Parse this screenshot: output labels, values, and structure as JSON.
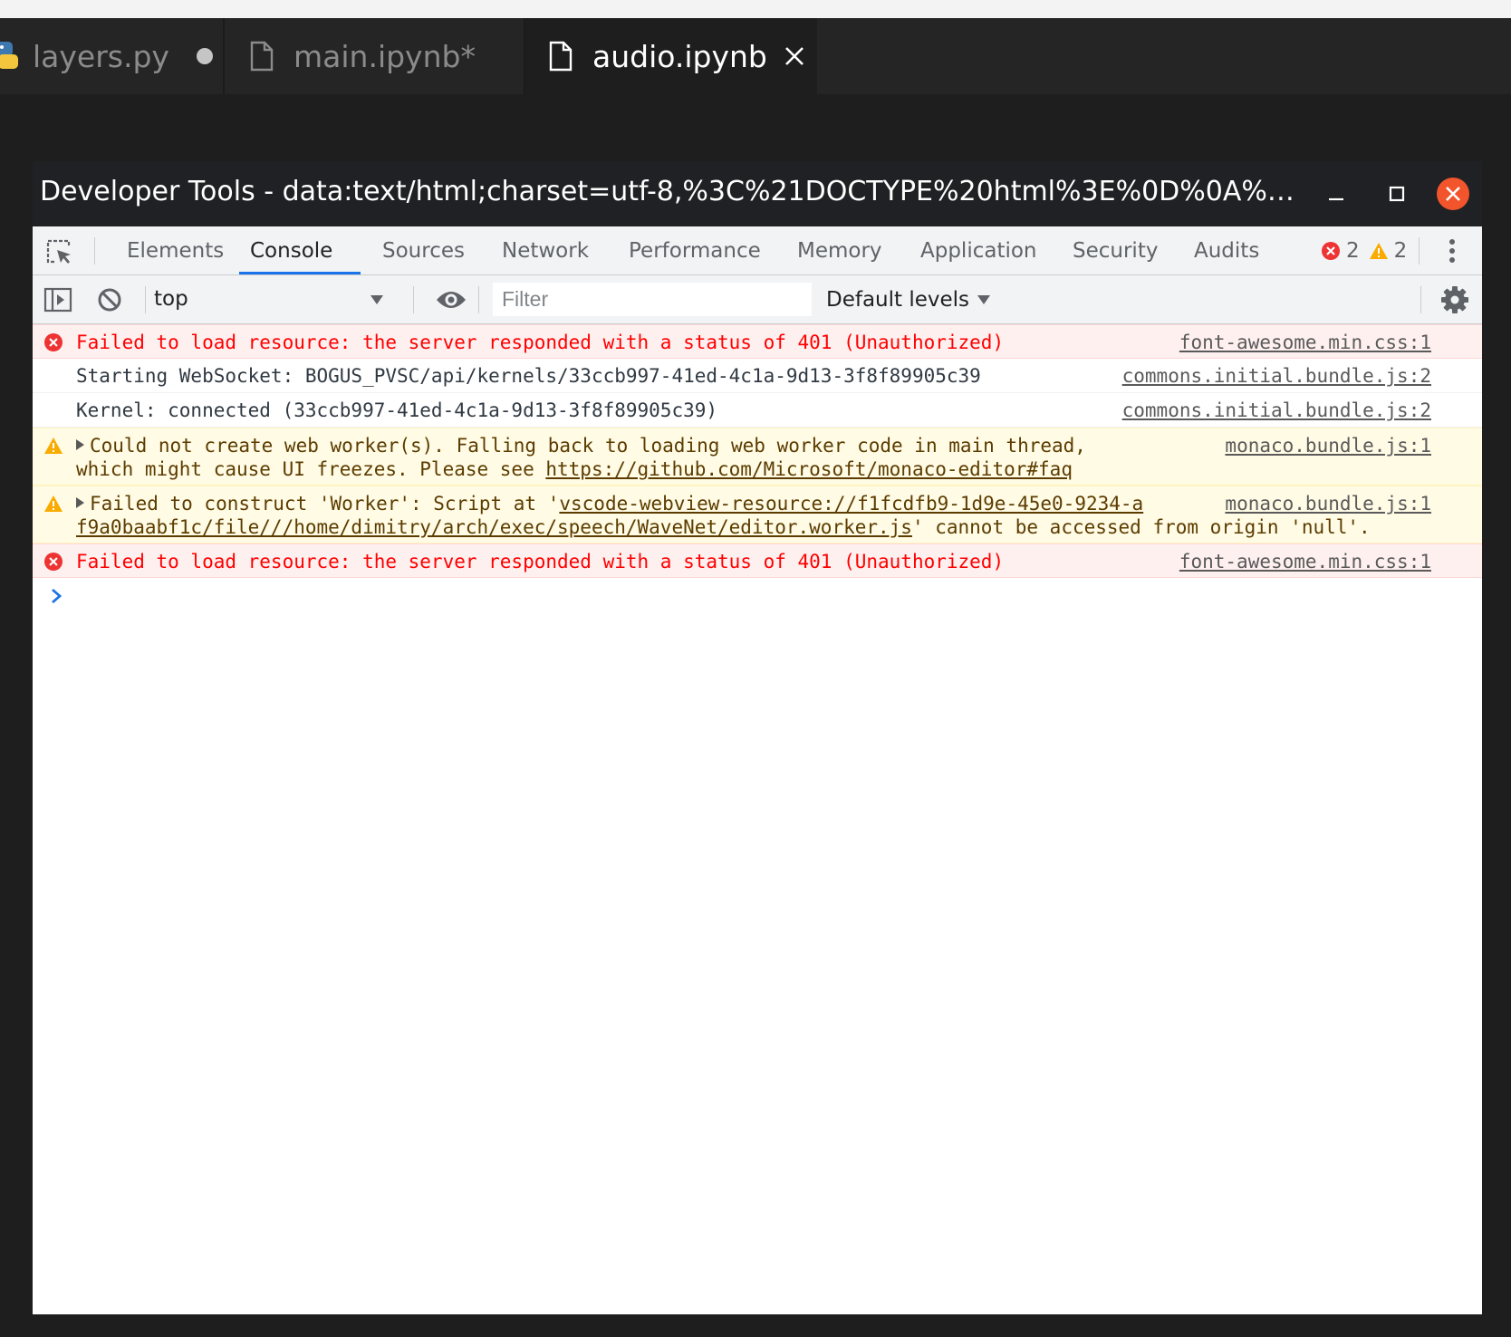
{
  "editor_tabs": [
    {
      "label": "layers.py",
      "icon": "python-icon",
      "status": "dirty-dot"
    },
    {
      "label": "main.ipynb*",
      "icon": "file-icon",
      "status": ""
    },
    {
      "label": "audio.ipynb",
      "icon": "file-icon",
      "status": "close"
    }
  ],
  "devtools": {
    "title": "Developer Tools - data:text/html;charset=utf-8,%3C%21DOCTYPE%20html%3E%0D%0A%3Chtml%...",
    "panel_tabs": [
      "Elements",
      "Console",
      "Sources",
      "Network",
      "Performance",
      "Memory",
      "Application",
      "Security",
      "Audits"
    ],
    "active_tab": "Console",
    "error_count": "2",
    "warning_count": "2",
    "toolbar": {
      "context": "top",
      "filter_placeholder": "Filter",
      "levels": "Default levels"
    },
    "messages": [
      {
        "level": "error",
        "text": "Failed to load resource: the server responded with a status of 401 (Unauthorized)",
        "source": "font-awesome.min.css:1"
      },
      {
        "level": "log",
        "text": "Starting WebSocket: BOGUS_PVSC/api/kernels/33ccb997-41ed-4c1a-9d13-3f8f89905c39",
        "source": "commons.initial.bundle.js:2"
      },
      {
        "level": "log",
        "text": "Kernel: connected (33ccb997-41ed-4c1a-9d13-3f8f89905c39)",
        "source": "commons.initial.bundle.js:2"
      },
      {
        "level": "warning",
        "line1": "Could not create web worker(s). Falling back to loading web worker code in main thread,",
        "line2_pre": "which might cause UI freezes. Please see ",
        "line2_link": "https://github.com/Microsoft/monaco-editor#faq",
        "source": "monaco.bundle.js:1"
      },
      {
        "level": "warning",
        "line1_pre": "Failed to construct 'Worker': Script at '",
        "line1_link": "vscode-webview-resource://f1fcdfb9-1d9e-45e0-9234-a",
        "line2_link": "f9a0baabf1c/file///home/dimitry/arch/exec/speech/WaveNet/editor.worker.js",
        "line2_post": "' cannot be accessed from origin 'null'.",
        "source": "monaco.bundle.js:1"
      },
      {
        "level": "error",
        "text": "Failed to load resource: the server responded with a status of 401 (Unauthorized)",
        "source": "font-awesome.min.css:1"
      }
    ]
  },
  "colors": {
    "accent": "#1a73e8",
    "error": "#ff0000",
    "warning": "#f9ab00",
    "close_button": "#f2552c"
  }
}
